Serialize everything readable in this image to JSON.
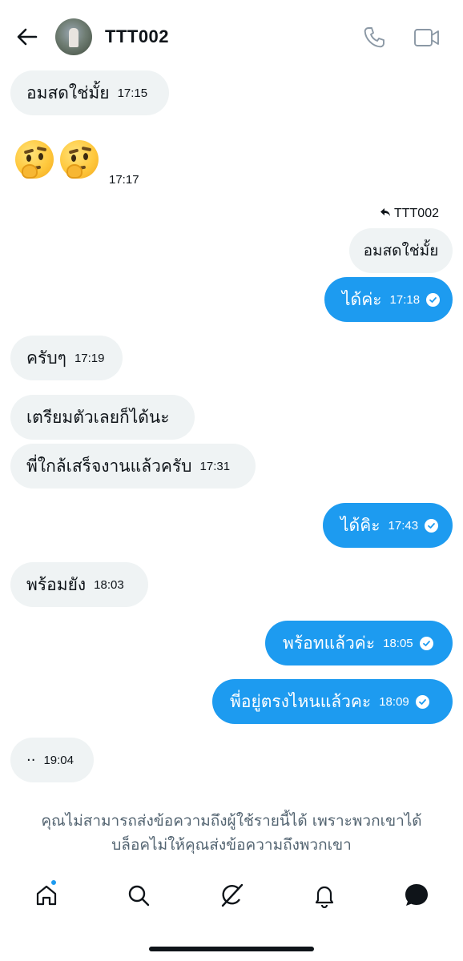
{
  "header": {
    "contact_name": "TTT002",
    "icons": [
      "back-arrow-icon",
      "avatar",
      "phone-icon",
      "video-icon"
    ]
  },
  "messages": [
    {
      "direction": "in",
      "text": "อมสดใช่มั้ย",
      "time": "17:15"
    },
    {
      "direction": "in",
      "type": "emoji",
      "emojis": [
        "🤔",
        "🤔"
      ],
      "time": "17:17"
    },
    {
      "direction": "out",
      "reply_to": "TTT002",
      "quoted_text": "อมสดใช่มั้ย",
      "text": "ได้ค่ะ",
      "time": "17:18",
      "seen": true
    },
    {
      "direction": "in",
      "text": "ครับๆ",
      "time": "17:19"
    },
    {
      "direction": "in",
      "text": "เตรียมตัวเลยก็ได้นะ",
      "time": ""
    },
    {
      "direction": "in",
      "text": "พี่ใกล้เสร็จงานแล้วครับ",
      "time": "17:31"
    },
    {
      "direction": "out",
      "text": "ได้คิะ",
      "time": "17:43",
      "seen": true
    },
    {
      "direction": "in",
      "text": "พร้อมยัง",
      "time": "18:03"
    },
    {
      "direction": "out",
      "text": "พร้อทแล้วค่ะ",
      "time": "18:05",
      "seen": true
    },
    {
      "direction": "out",
      "text": "พี่อยู่ตรงไหนแล้วคะ",
      "time": "18:09",
      "seen": true
    },
    {
      "direction": "in",
      "text": "··",
      "time": "19:04"
    }
  ],
  "blocked_notice": {
    "line1": "คุณไม่สามารถส่งข้อความถึงผู้ใช้รายนี้ได้ เพราะพวกเขาได้",
    "line2": "บล็อคไม่ให้คุณส่งข้อความถึงพวกเขา"
  },
  "nav": {
    "items": [
      "home-icon",
      "search-icon",
      "grok-icon",
      "notifications-bell-icon",
      "messages-icon"
    ],
    "active": "messages-icon",
    "home_has_notification_dot": true
  },
  "colors": {
    "accent": "#1d9bf0",
    "incoming_bubble": "#eff3f4",
    "text_primary": "#0f1419",
    "text_secondary": "#536471"
  }
}
